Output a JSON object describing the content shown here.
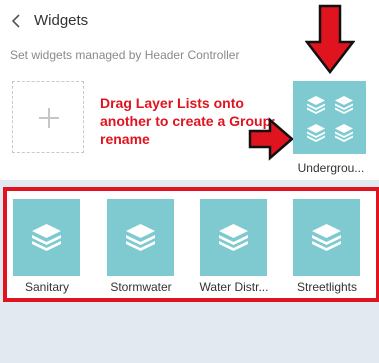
{
  "header": {
    "title": "Widgets",
    "subtitle": "Set widgets managed by Header Controller"
  },
  "annotation": {
    "text": "Drag Layer Lists onto another to create a Group; rename"
  },
  "group": {
    "label": "Undergrou...",
    "icon": "layers-icon"
  },
  "widgets": [
    {
      "label": "Sanitary",
      "icon": "layers-icon"
    },
    {
      "label": "Stormwater",
      "icon": "layers-icon"
    },
    {
      "label": "Water Distr...",
      "icon": "layers-icon"
    },
    {
      "label": "Streetlights",
      "icon": "layers-icon"
    }
  ],
  "colors": {
    "tile": "#7ecad0",
    "annotation": "#e0141e",
    "panel": "#e3e9f0"
  }
}
